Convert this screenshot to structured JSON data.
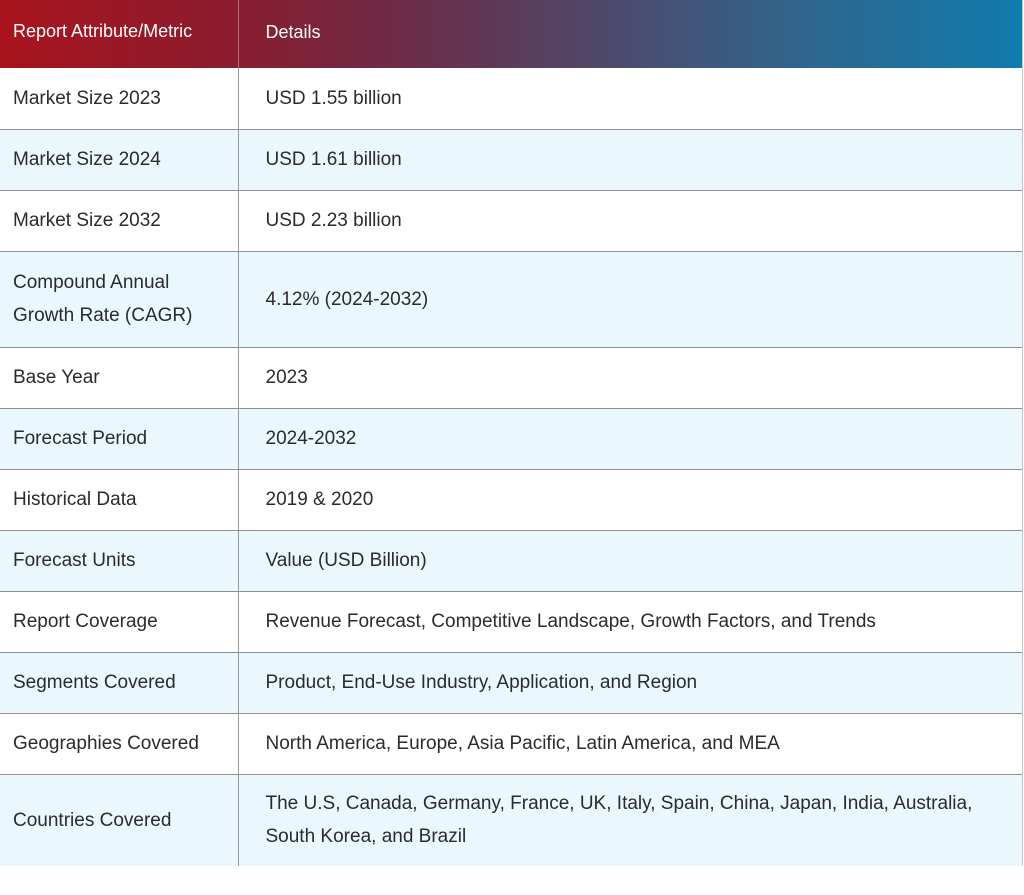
{
  "table": {
    "header": {
      "attribute": "Report Attribute/Metric",
      "details": "Details"
    },
    "rows": [
      {
        "attribute": "Market Size 2023",
        "details": "USD 1.55 billion"
      },
      {
        "attribute": "Market Size 2024",
        "details": "USD 1.61 billion"
      },
      {
        "attribute": "Market Size 2032",
        "details": "USD 2.23 billion"
      },
      {
        "attribute": "Compound Annual Growth Rate (CAGR)",
        "details": "4.12% (2024-2032)"
      },
      {
        "attribute": "Base Year",
        "details": "2023"
      },
      {
        "attribute": "Forecast Period",
        "details": "2024-2032"
      },
      {
        "attribute": "Historical Data",
        "details": "2019 & 2020"
      },
      {
        "attribute": "Forecast Units",
        "details": "Value (USD Billion)"
      },
      {
        "attribute": "Report Coverage",
        "details": "Revenue Forecast, Competitive Landscape, Growth Factors, and Trends"
      },
      {
        "attribute": "Segments Covered",
        "details": "Product, End-Use Industry, Application, and Region"
      },
      {
        "attribute": "Geographies Covered",
        "details": "North America, Europe, Asia Pacific, Latin America, and MEA"
      },
      {
        "attribute": "Countries Covered",
        "details": "The U.S, Canada, Germany, France, UK, Italy, Spain, China, Japan, India, Australia, South Korea, and Brazil"
      }
    ],
    "colors": {
      "header_start": "#a8141d",
      "header_end": "#0f7bac",
      "row_alt": "#eaf7fd",
      "text": "#2b2b2b"
    }
  }
}
